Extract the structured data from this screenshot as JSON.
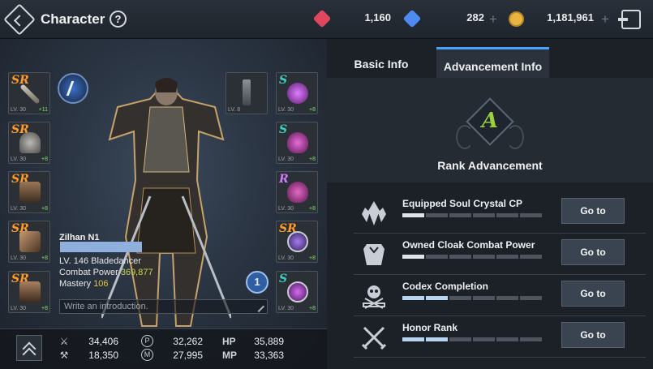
{
  "header": {
    "title": "Character",
    "help_label": "?",
    "currencies": [
      {
        "name": "red-gem-icon",
        "color": "#e0465e",
        "value": "1,160"
      },
      {
        "name": "blue-gem-icon",
        "color": "#4d8bf0",
        "value": "282"
      },
      {
        "name": "gold-coin-icon",
        "color": "#e8b540",
        "value": "1,181,961"
      }
    ],
    "plus_label": "+"
  },
  "equipment": {
    "left": [
      {
        "grade": "SR",
        "lv": "LV. 30",
        "plus": "+11",
        "color": "#c8c3b6"
      },
      {
        "grade": "SR",
        "lv": "LV. 30",
        "plus": "+8",
        "color": "#9b9a97"
      },
      {
        "grade": "SR",
        "lv": "LV. 30",
        "plus": "+8",
        "color": "#8a6b4e"
      },
      {
        "grade": "SR",
        "lv": "LV. 30",
        "plus": "+8",
        "color": "#a77b5a"
      },
      {
        "grade": "SR",
        "lv": "LV. 30",
        "plus": "+8",
        "color": "#8e6a4a"
      }
    ],
    "center": {
      "lv": "LV. 8",
      "color": "#7a7f87"
    },
    "right": [
      {
        "grade": "S",
        "lv": "LV. 30",
        "plus": "+8",
        "color": "#b94fc9"
      },
      {
        "grade": "S",
        "lv": "LV. 30",
        "plus": "+8",
        "color": "#c04ab5"
      },
      {
        "grade": "R",
        "lv": "LV. 30",
        "plus": "+8",
        "color": "#c24ea9"
      },
      {
        "grade": "SR",
        "lv": "LV. 30",
        "plus": "+8",
        "color": "#8d6fd1"
      },
      {
        "grade": "S",
        "lv": "LV. 30",
        "plus": "+8",
        "color": "#b24fc4"
      }
    ]
  },
  "character": {
    "name": "Zilhan N1",
    "level_line": "LV. 146  Bladedancer",
    "cp_label": "Combat Power",
    "cp_value": "369,877",
    "mastery_label": "Mastery",
    "mastery_value": "106",
    "intro_placeholder": "Write an introduction.",
    "badge": "1"
  },
  "stats": {
    "attack": "34,406",
    "defense": "18,350",
    "p_stat": "32,262",
    "m_stat": "27,995",
    "p_label": "P",
    "m_label": "M",
    "hp_label": "HP",
    "hp": "35,889",
    "mp_label": "MP",
    "mp": "33,363"
  },
  "tabs": {
    "basic": "Basic Info",
    "advancement": "Advancement Info",
    "active": "advancement"
  },
  "advancement": {
    "rank_letter": "A",
    "rank_title": "Rank Advancement",
    "rows": [
      {
        "title": "Equipped Soul Crystal CP",
        "icon": "soul-crystal-icon",
        "progress": 1,
        "segments": 6,
        "button": "Go to"
      },
      {
        "title": "Owned Cloak Combat Power",
        "icon": "cloak-icon",
        "progress": 1,
        "segments": 6,
        "button": "Go to"
      },
      {
        "title": "Codex Completion",
        "icon": "codex-skull-icon",
        "progress": 2,
        "segments": 6,
        "button": "Go to"
      },
      {
        "title": "Honor Rank",
        "icon": "crossed-swords-icon",
        "progress": 2,
        "segments": 6,
        "button": "Go to"
      }
    ]
  }
}
